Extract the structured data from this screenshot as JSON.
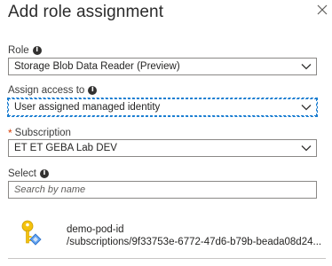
{
  "header": {
    "title": "Add role assignment"
  },
  "role": {
    "label": "Role",
    "value": "Storage Blob Data Reader (Preview)"
  },
  "assign_access": {
    "label": "Assign access to",
    "value": "User assigned managed identity"
  },
  "subscription": {
    "required_marker": "*",
    "label": "Subscription",
    "value": "ET ET GEBA Lab DEV"
  },
  "select": {
    "label": "Select",
    "placeholder": "Search by name"
  },
  "results": [
    {
      "name": "demo-pod-id",
      "path": "/subscriptions/9f33753e-6772-47d6-b79b-beada08d24..."
    }
  ],
  "icons": {
    "close": "close-icon",
    "info": "info-icon",
    "chevron": "chevron-down-icon",
    "identity": "managed-identity-key-icon"
  },
  "colors": {
    "focus_border": "#1b7ed1",
    "required": "#d83b01",
    "key_yellow": "#f4c20d",
    "identity_blue": "#5ea0ef"
  }
}
